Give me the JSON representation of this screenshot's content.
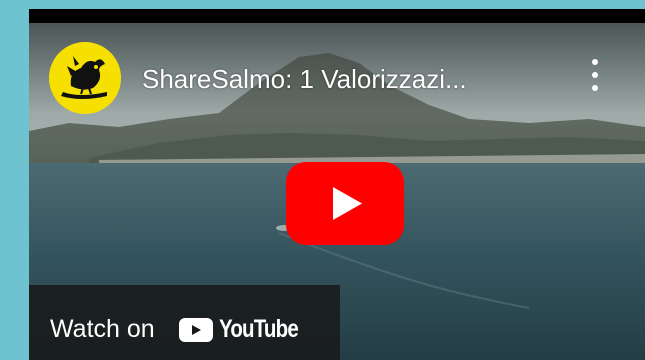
{
  "video": {
    "title": "ShareSalmo: 1 Valorizzazi...",
    "menu_icon": "more-vert-icon",
    "play_icon": "youtube-play-icon",
    "channel_avatar": "bird-avatar",
    "watch_on": {
      "label": "Watch on",
      "brand": "YouTube",
      "brand_icon": "youtube-logo-icon"
    }
  },
  "colors": {
    "page_background": "#6fc3d0",
    "play_red": "#ff0000",
    "avatar_yellow": "#f5e000",
    "watch_bar": "#171717"
  }
}
